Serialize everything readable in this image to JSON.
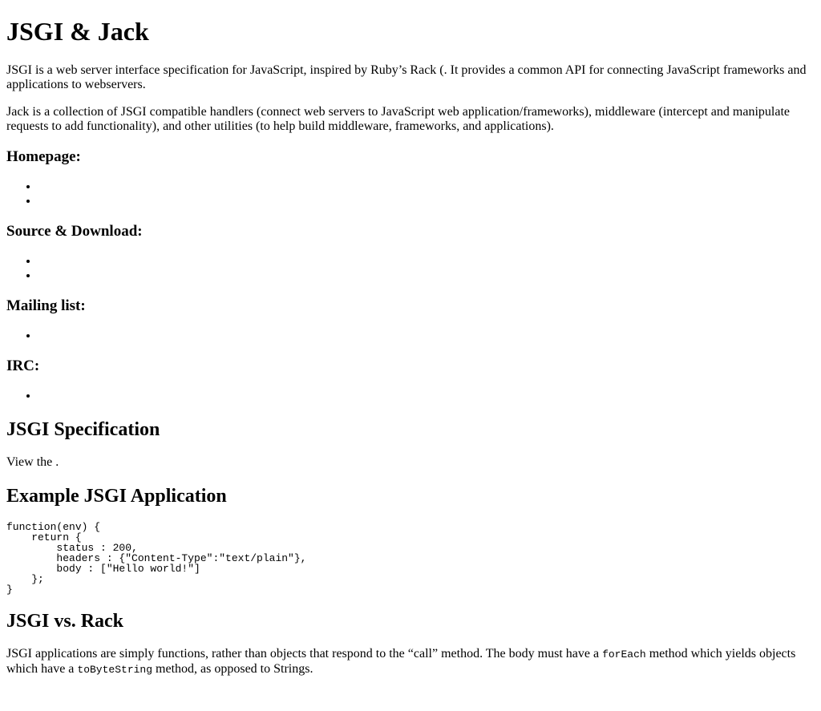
{
  "title": "JSGI & Jack",
  "intro": {
    "p1": "JSGI is a web server interface specification for JavaScript, inspired by Ruby’s Rack (. It provides a common API for connecting JavaScript frameworks and applications to webservers.",
    "p2": "Jack is a collection of JSGI compatible handlers (connect web servers to JavaScript web application/frameworks), middleware (intercept and manipulate requests to add functionality), and other utilities (to help build middleware, frameworks, and applications)."
  },
  "homepage": {
    "heading": "Homepage:",
    "items": [
      "",
      ""
    ]
  },
  "source": {
    "heading": "Source & Download:",
    "items": [
      "",
      ""
    ]
  },
  "mailing": {
    "heading": "Mailing list:",
    "items": [
      ""
    ]
  },
  "irc": {
    "heading": "IRC:",
    "items": [
      ""
    ]
  },
  "spec": {
    "heading": "JSGI Specification",
    "text": "View the ."
  },
  "example": {
    "heading": "Example JSGI Application",
    "code": "function(env) {\n    return {\n        status : 200,\n        headers : {\"Content-Type\":\"text/plain\"},\n        body : [\"Hello world!\"]\n    };\n}"
  },
  "vs": {
    "heading": "JSGI vs. Rack",
    "text_a": "JSGI applications are simply functions, rather than objects that respond to the “call” method. The body must have a ",
    "code_a": "forEach",
    "text_b": " method which yields objects which have a ",
    "code_b": "toByteString",
    "text_c": " method, as opposed to Strings."
  }
}
